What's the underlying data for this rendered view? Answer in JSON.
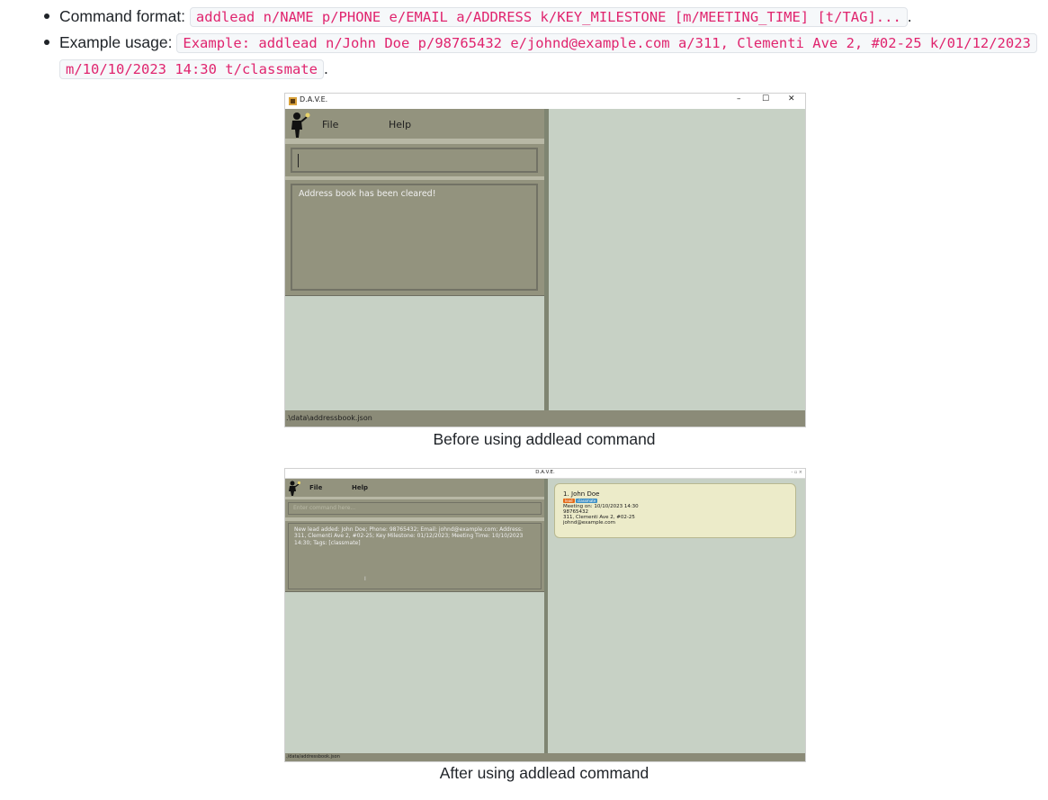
{
  "bullets": [
    {
      "label": "Command format:",
      "code": "addlead n/NAME p/PHONE e/EMAIL a/ADDRESS k/KEY_MILESTONE [m/MEETING_TIME] [t/TAG]...",
      "trail": "."
    },
    {
      "label": "Example usage:",
      "code": "Example: addlead n/John Doe p/98765432 e/johnd@example.com a/311, Clementi Ave 2, #02-25 k/01/12/2023 m/10/10/2023 14:30 t/classmate",
      "trail": "."
    }
  ],
  "before": {
    "window_title": "D.A.V.E.",
    "menu_file": "File",
    "menu_help": "Help",
    "result_text": "Address book has been cleared!",
    "status_path": ".\\data\\addressbook.json",
    "caption": "Before using addlead command",
    "win_min": "–",
    "win_max": "☐",
    "win_close": "✕"
  },
  "after": {
    "window_title": "D.A.V.E.",
    "menu_file": "File",
    "menu_help": "Help",
    "command_placeholder": "Enter command here...",
    "result_text": "New lead added: John Doe; Phone: 98765432; Email: johnd@example.com; Address: 311, Clementi Ave 2, #02-25; Key Milestone: 01/12/2023; Meeting Time: 10/10/2023 14:30; Tags: [classmate]",
    "cursor_glyph": "I",
    "status_path": "./data/addressbook.json",
    "caption": "After using addlead command",
    "card": {
      "index": "1.",
      "name": "John Doe",
      "tag_lead": "lead",
      "tag_other": "classmate",
      "meeting": "Meeting on: 10/10/2023 14:30",
      "phone": "98765432",
      "address": "311, Clementi Ave 2, #02-25",
      "email": "johnd@example.com"
    },
    "win_controls": "- ▫ ×"
  },
  "colors": {
    "code_pink": "#e0246e",
    "app_bg": "#c7d1c5",
    "panel": "#93937e",
    "card_bg": "#ecebc9",
    "tag_lead": "#e36a1a",
    "tag_other": "#3d8fc4"
  }
}
